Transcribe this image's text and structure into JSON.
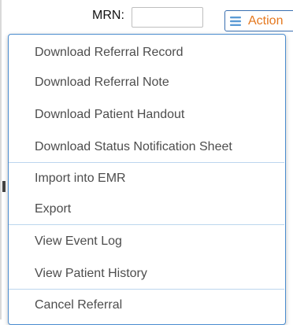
{
  "header": {
    "mrn_label": "MRN:",
    "mrn_value": "",
    "action_button_label": "Action",
    "action_icon": "hamburger-icon"
  },
  "menu": {
    "groups": [
      {
        "items": [
          {
            "label": "Download Referral Record"
          },
          {
            "label": "Download Referral Note"
          },
          {
            "label": "Download Patient Handout"
          },
          {
            "label": "Download Status Notification Sheet"
          }
        ]
      },
      {
        "items": [
          {
            "label": "Import into EMR"
          },
          {
            "label": "Export"
          }
        ]
      },
      {
        "items": [
          {
            "label": "View Event Log"
          },
          {
            "label": "View Patient History"
          }
        ]
      },
      {
        "items": [
          {
            "label": "Cancel Referral"
          }
        ]
      }
    ]
  },
  "colors": {
    "action_text": "#e5781f",
    "action_border": "#3a6fb0",
    "menu_border": "#4a8ccf",
    "menu_text": "#4d4d4d",
    "divider": "#bcd6ee",
    "hamburger": "#5b9bd5"
  }
}
